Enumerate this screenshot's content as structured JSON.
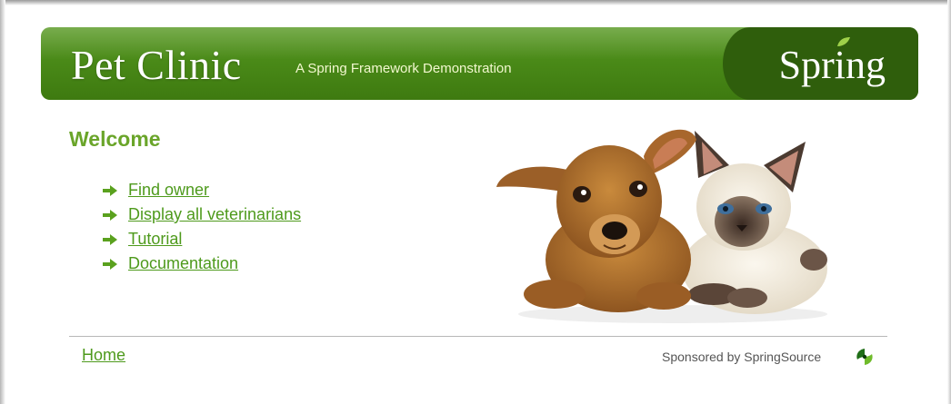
{
  "header": {
    "title": "Pet Clinic",
    "subtitle": "A Spring Framework Demonstration",
    "logo_text": "Spring",
    "colors": {
      "green": "#4a8a18",
      "dark_green": "#2f5e0c",
      "accent": "#6aa52a"
    }
  },
  "main": {
    "heading": "Welcome",
    "links": [
      {
        "label": "Find owner",
        "icon": "arrow-right-icon"
      },
      {
        "label": "Display all veterinarians",
        "icon": "arrow-right-icon"
      },
      {
        "label": "Tutorial",
        "icon": "arrow-right-icon"
      },
      {
        "label": "Documentation",
        "icon": "arrow-right-icon"
      }
    ],
    "image": "puppy-and-kitten-photo"
  },
  "footer": {
    "home_label": "Home",
    "sponsor_text": "Sponsored by SpringSource",
    "sponsor_icon": "springsource-logo-icon"
  }
}
